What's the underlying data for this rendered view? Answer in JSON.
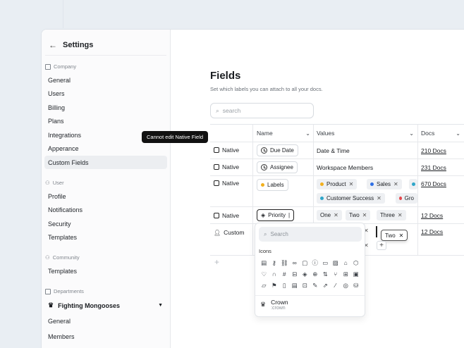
{
  "sidebar": {
    "title": "Settings",
    "groups": [
      {
        "label": "Company",
        "items": [
          "General",
          "Users",
          "Billing",
          "Plans",
          "Integrations",
          "Apperance",
          "Custom Fields"
        ]
      },
      {
        "label": "User",
        "items": [
          "Profile",
          "Notifications",
          "Security",
          "Templates"
        ]
      },
      {
        "label": "Community",
        "items": [
          "Templates"
        ]
      },
      {
        "label": "Departments",
        "team": "Fighting Mongooses",
        "items": [
          "General",
          "Members"
        ]
      }
    ],
    "active_item": "Custom Fields"
  },
  "main": {
    "title": "Fields",
    "subtitle": "Set which labels you can attach to all your docs.",
    "search_placeholder": "search",
    "columns": {
      "name": "Name",
      "values": "Values",
      "docs": "Docs"
    },
    "tooltip": "Cannot edit Native Field",
    "rows": [
      {
        "type": "Native",
        "name": "Due Date",
        "values_text": "Date & Time",
        "docs": "210 Docs"
      },
      {
        "type": "Native",
        "name": "Assignee",
        "values_text": "Workspace Members",
        "docs": "231 Docs"
      },
      {
        "type": "Native",
        "name": "Labels",
        "tags": [
          "Product",
          "Sales",
          "Customer Success",
          "Gro"
        ],
        "docs": "670 Docs"
      },
      {
        "type": "Native",
        "name": "Priority",
        "tags": [
          "One",
          "Two",
          "Three"
        ],
        "docs": "12 Docs"
      },
      {
        "type": "Custom",
        "docs": "12 Docs"
      }
    ]
  },
  "icon_picker": {
    "search_placeholder": "Search",
    "section_label": "Icons",
    "result_name": "Crown",
    "result_code": ":crown",
    "dragged_tag": "Two"
  },
  "colors": {
    "product": "#f2b01e",
    "sales": "#2f6fe4",
    "customer_success": "#2fa6c9",
    "growth": "#e5484d"
  }
}
